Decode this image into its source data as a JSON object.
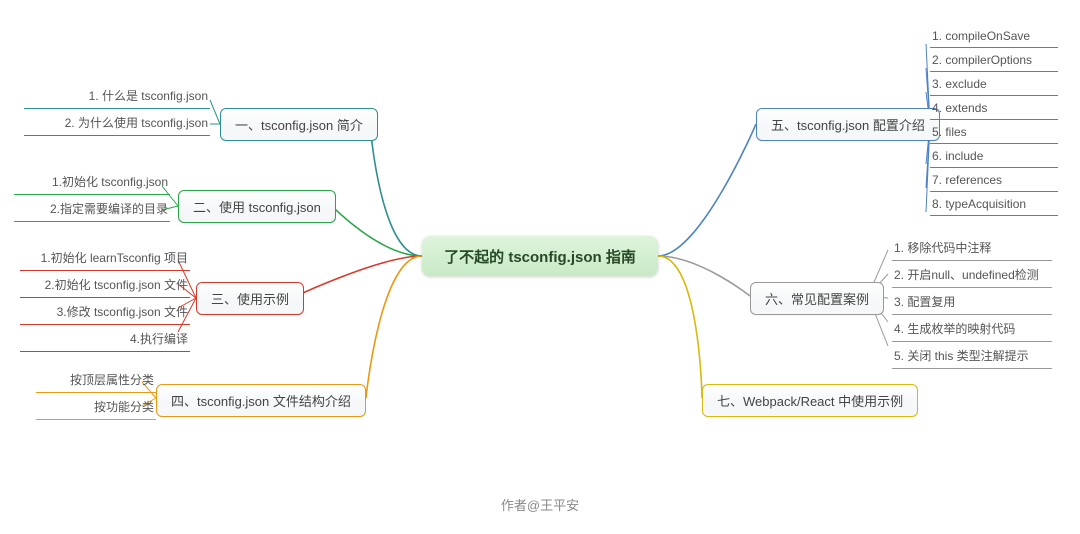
{
  "center": {
    "title": "了不起的 tsconfig.json 指南"
  },
  "author": "作者@王平安",
  "left": {
    "n1": {
      "label": "一、tsconfig.json 简介",
      "leaves": [
        "1. 什么是 tsconfig.json",
        "2. 为什么使用 tsconfig.json"
      ]
    },
    "n2": {
      "label": "二、使用 tsconfig.json",
      "leaves": [
        "1.初始化 tsconfig.json",
        "2.指定需要编译的目录"
      ]
    },
    "n3": {
      "label": "三、使用示例",
      "leaves": [
        "1.初始化 learnTsconfig 项目",
        "2.初始化 tsconfig.json 文件",
        "3.修改 tsconfig.json 文件",
        "4.执行编译"
      ]
    },
    "n4": {
      "label": "四、tsconfig.json 文件结构介绍",
      "leaves": [
        "按顶层属性分类",
        "按功能分类"
      ]
    }
  },
  "right": {
    "n5": {
      "label": "五、tsconfig.json 配置介绍",
      "leaves": [
        "1. compileOnSave",
        "2. compilerOptions",
        "3. exclude",
        "4. extends",
        "5. files",
        "6. include",
        "7. references",
        "8. typeAcquisition"
      ]
    },
    "n6": {
      "label": "六、常见配置案例",
      "leaves": [
        "1. 移除代码中注释",
        "2. 开启null、undefined检测",
        "3. 配置复用",
        "4. 生成枚举的映射代码",
        "5. 关闭 this 类型注解提示"
      ]
    },
    "n7": {
      "label": "七、Webpack/React 中使用示例"
    }
  }
}
